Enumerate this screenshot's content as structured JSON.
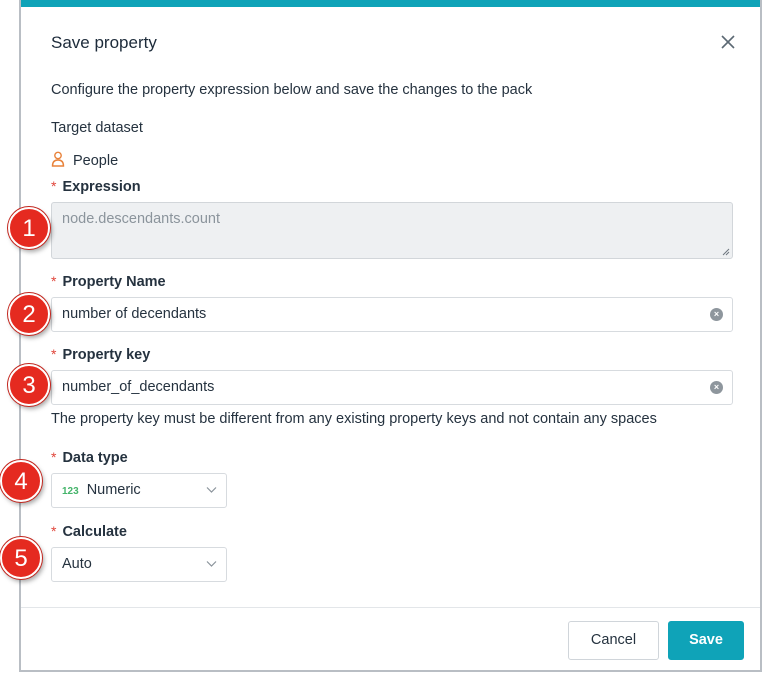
{
  "dialog": {
    "title": "Save property",
    "description": "Configure the property expression below and save the changes to the pack",
    "target_dataset_label": "Target dataset",
    "target_dataset_value": "People",
    "target_dataset_icon": "person-icon",
    "accent_color": "#0fa3b8",
    "required_marker": "*"
  },
  "fields": {
    "expression": {
      "label": "Expression",
      "placeholder": "node.descendants.count"
    },
    "property_name": {
      "label": "Property Name",
      "value": "number of decendants"
    },
    "property_key": {
      "label": "Property key",
      "value": "number_of_decendants",
      "hint": "The property key must be different from any existing property keys and not contain any spaces"
    },
    "data_type": {
      "label": "Data type",
      "badge": "123",
      "value": "Numeric"
    },
    "calculate": {
      "label": "Calculate",
      "value": "Auto"
    }
  },
  "buttons": {
    "cancel": "Cancel",
    "save": "Save"
  },
  "markers": [
    "1",
    "2",
    "3",
    "4",
    "5"
  ]
}
